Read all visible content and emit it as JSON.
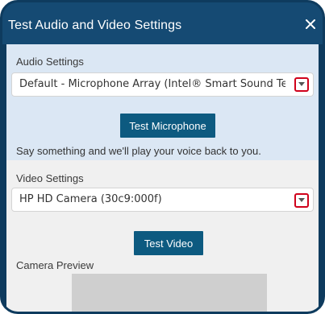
{
  "dialog": {
    "title": "Test Audio and Video Settings",
    "close_icon": "close-icon"
  },
  "audio": {
    "label": "Audio Settings",
    "selected_device": "Default - Microphone Array (Intel® Smart Sound Technolo...",
    "test_button": "Test Microphone",
    "helper_text": "Say something and we'll play your voice back to you."
  },
  "video": {
    "label": "Video Settings",
    "selected_device": "HP HD Camera (30c9:000f)",
    "test_button": "Test Video",
    "preview_label": "Camera Preview"
  },
  "colors": {
    "header_bg": "#154a73",
    "audio_bg": "#dbe7f4",
    "video_bg": "#f0f0f0",
    "button_bg": "#0d5a80",
    "highlight_red": "#d0021b"
  }
}
